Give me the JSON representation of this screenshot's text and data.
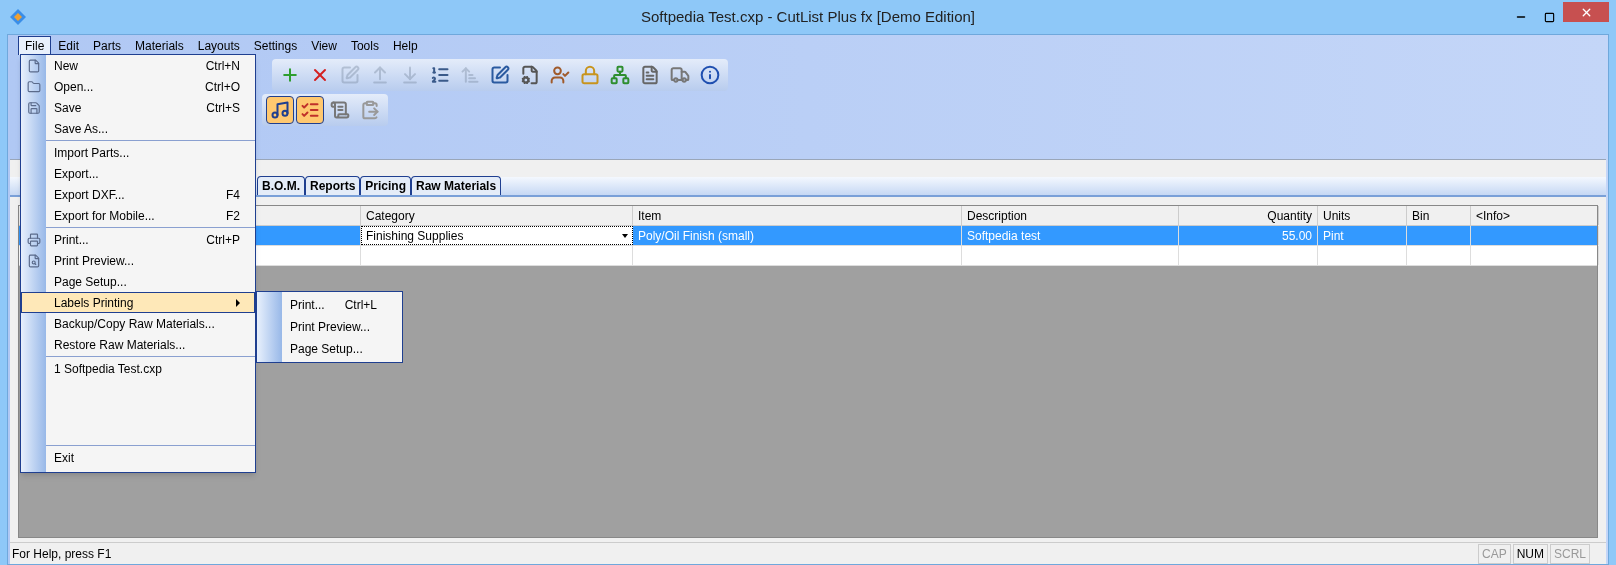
{
  "window": {
    "title": "Softpedia Test.cxp - CutList Plus fx [Demo Edition]"
  },
  "menu_bar": [
    {
      "label": "File",
      "selected": true
    },
    {
      "label": "Edit",
      "selected": false
    },
    {
      "label": "Parts",
      "selected": false
    },
    {
      "label": "Materials",
      "selected": false
    },
    {
      "label": "Layouts",
      "selected": false
    },
    {
      "label": "Settings",
      "selected": false
    },
    {
      "label": "View",
      "selected": false
    },
    {
      "label": "Tools",
      "selected": false
    },
    {
      "label": "Help",
      "selected": false
    }
  ],
  "toolbar_rows": [
    [
      {
        "kind": "add",
        "disabled": false
      },
      {
        "kind": "delete",
        "disabled": false
      },
      {
        "kind": "edit",
        "disabled": true
      },
      {
        "kind": "up",
        "disabled": true
      },
      {
        "kind": "down",
        "disabled": true
      },
      {
        "kind": "numbered",
        "disabled": false
      },
      {
        "kind": "sort",
        "disabled": true
      },
      {
        "kind": "pencil",
        "disabled": false
      },
      {
        "kind": "settings",
        "disabled": false
      },
      {
        "kind": "user",
        "disabled": false
      },
      {
        "kind": "lock",
        "disabled": false
      },
      {
        "kind": "tree",
        "disabled": false
      },
      {
        "kind": "document",
        "disabled": false
      },
      {
        "kind": "truck",
        "disabled": false
      },
      {
        "kind": "info",
        "disabled": false
      }
    ],
    [
      {
        "kind": "music",
        "selected": true
      },
      {
        "kind": "list",
        "selected": true
      },
      {
        "kind": "scroll",
        "selected": false
      },
      {
        "kind": "paste",
        "selected": false
      }
    ]
  ],
  "tabs": [
    {
      "label": "B.O.M.",
      "selected": false
    },
    {
      "label": "Reports",
      "selected": false
    },
    {
      "label": "Pricing",
      "selected": false
    },
    {
      "label": "Raw Materials",
      "selected": false
    }
  ],
  "table": {
    "columns": [
      {
        "kind": "text"
      },
      {
        "label": "Category",
        "kind": "dropdown"
      },
      {
        "label": "Item",
        "kind": "text"
      },
      {
        "label": "Description",
        "kind": "text"
      },
      {
        "label": "Quantity",
        "kind": "number"
      },
      {
        "label": "Units",
        "kind": "text"
      },
      {
        "label": "Bin",
        "kind": "text"
      },
      {
        "label": "<Info>",
        "kind": "text"
      }
    ],
    "rows": [
      {
        "selected": true,
        "cells": [
          null,
          "Finishing Supplies",
          "Poly/Oil Finish (small)",
          "Softpedia test",
          "55.00",
          "Pint",
          null,
          null
        ]
      },
      {
        "selected": false
      }
    ]
  },
  "file_menu": {
    "sections": [
      [
        {
          "label": "New",
          "shortcut": "Ctrl+N",
          "selected": false
        },
        {
          "label": "Open...",
          "shortcut": "Ctrl+O",
          "selected": false
        },
        {
          "label": "Save",
          "shortcut": "Ctrl+S",
          "selected": false
        },
        {
          "label": "Save As...",
          "selected": false
        }
      ],
      [
        {
          "label": "Import Parts...",
          "selected": false
        },
        {
          "label": "Export...",
          "selected": false
        },
        {
          "label": "Export DXF...",
          "shortcut": "F4",
          "selected": false
        },
        {
          "label": "Export for Mobile...",
          "shortcut": "F2",
          "selected": false
        }
      ],
      [
        {
          "label": "Print...",
          "shortcut": "Ctrl+P",
          "selected": false
        },
        {
          "label": "Print Preview...",
          "selected": false
        },
        {
          "label": "Page Setup...",
          "selected": false
        },
        {
          "label": "Labels Printing",
          "selected": true,
          "submenu": [
            {
              "label": "Print...",
              "shortcut": "Ctrl+L"
            },
            {
              "label": "Print Preview..."
            },
            {
              "label": "Page Setup..."
            }
          ]
        },
        {
          "label": "Backup/Copy Raw Materials...",
          "selected": false
        },
        {
          "label": "Restore Raw Materials...",
          "selected": false
        }
      ],
      [
        {
          "label": "1 Softpedia Test.cxp",
          "selected": false
        }
      ],
      [
        {
          "label": "Exit",
          "selected": false
        }
      ]
    ]
  },
  "status_bar": {
    "text": "For Help, press F1",
    "indicators": [
      {
        "label": "CAP",
        "on": false
      },
      {
        "label": "NUM",
        "on": true
      },
      {
        "label": "SCRL",
        "on": false
      }
    ]
  }
}
